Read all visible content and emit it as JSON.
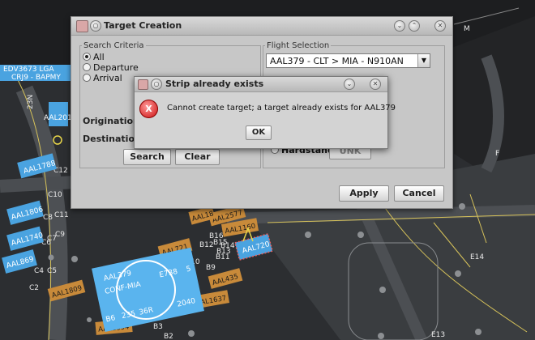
{
  "map": {
    "runway_text": "36R",
    "labels": [
      {
        "id": "M",
        "text": "M"
      },
      {
        "id": "F",
        "text": "F"
      },
      {
        "id": "E14",
        "text": "E14"
      },
      {
        "id": "E13",
        "text": "E13"
      },
      {
        "id": "C12",
        "text": "C12"
      },
      {
        "id": "C10",
        "text": "C10"
      },
      {
        "id": "C8",
        "text": "C8"
      },
      {
        "id": "C11",
        "text": "C11"
      },
      {
        "id": "C9",
        "text": "C9"
      },
      {
        "id": "C7",
        "text": "C7"
      },
      {
        "id": "C6",
        "text": "C6"
      },
      {
        "id": "C4",
        "text": "C4"
      },
      {
        "id": "C5",
        "text": "C5"
      },
      {
        "id": "C2",
        "text": "C2"
      },
      {
        "id": "B16",
        "text": "B16"
      },
      {
        "id": "B15",
        "text": "B15"
      },
      {
        "id": "B14",
        "text": "B14"
      },
      {
        "id": "B13",
        "text": "B13"
      },
      {
        "id": "B12",
        "text": "B12"
      },
      {
        "id": "B11",
        "text": "B11"
      },
      {
        "id": "B10",
        "text": "B10"
      },
      {
        "id": "B9",
        "text": "B9"
      },
      {
        "id": "B3",
        "text": "B3"
      },
      {
        "id": "B2",
        "text": "B2"
      },
      {
        "id": "23N",
        "text": "23N"
      }
    ],
    "strips": {
      "edv": "EDV3673 LGA",
      "crj": "CRJ9 - BAPMY",
      "aal201": "AAL201",
      "aal1788": "AAL1788",
      "aal1806": "AAL1806",
      "aal1740": "AAL1740",
      "aal869": "AAL869",
      "aal1809": "AAL1809",
      "aal1694": "AAL1694",
      "aal2577": "AAL2577",
      "aal18x": "AAL18",
      "aal1160": "AAL1160",
      "aal721": "AAL721",
      "aal720": "AAL720",
      "aal435": "AAL435",
      "aal1637": "AAL1637",
      "aal379": "AAL379",
      "conf": "CONF-MIA",
      "b6": "B6",
      "s235": "235",
      "e738": "E738",
      "s5": "5",
      "s2040": "2040"
    }
  },
  "target_dialog": {
    "title": "Target Creation",
    "search_criteria_legend": "Search Criteria",
    "radios": [
      {
        "label": "All",
        "selected": true
      },
      {
        "label": "Departure",
        "selected": false
      },
      {
        "label": "Arrival",
        "selected": false
      }
    ],
    "origination_label": "Origination",
    "destination_label": "Destination",
    "search_button": "Search",
    "clear_button": "Clear",
    "flight_selection_legend": "Flight Selection",
    "flight_selected": "AAL379 - CLT > MIA - N910AN",
    "hardstand_label": "Hardstand",
    "unk_button": "UNK",
    "apply_button": "Apply",
    "cancel_button": "Cancel"
  },
  "error_dialog": {
    "title": "Strip already exists",
    "icon": "error-x-icon",
    "message": "Cannot create target; a target already exists for AAL379",
    "ok_button": "OK"
  },
  "colors": {
    "tarmac": "#2a2c2f",
    "taxi": "#55585b",
    "flight_blue": "#4aa3e0",
    "tag_orange": "#c88a3a"
  }
}
